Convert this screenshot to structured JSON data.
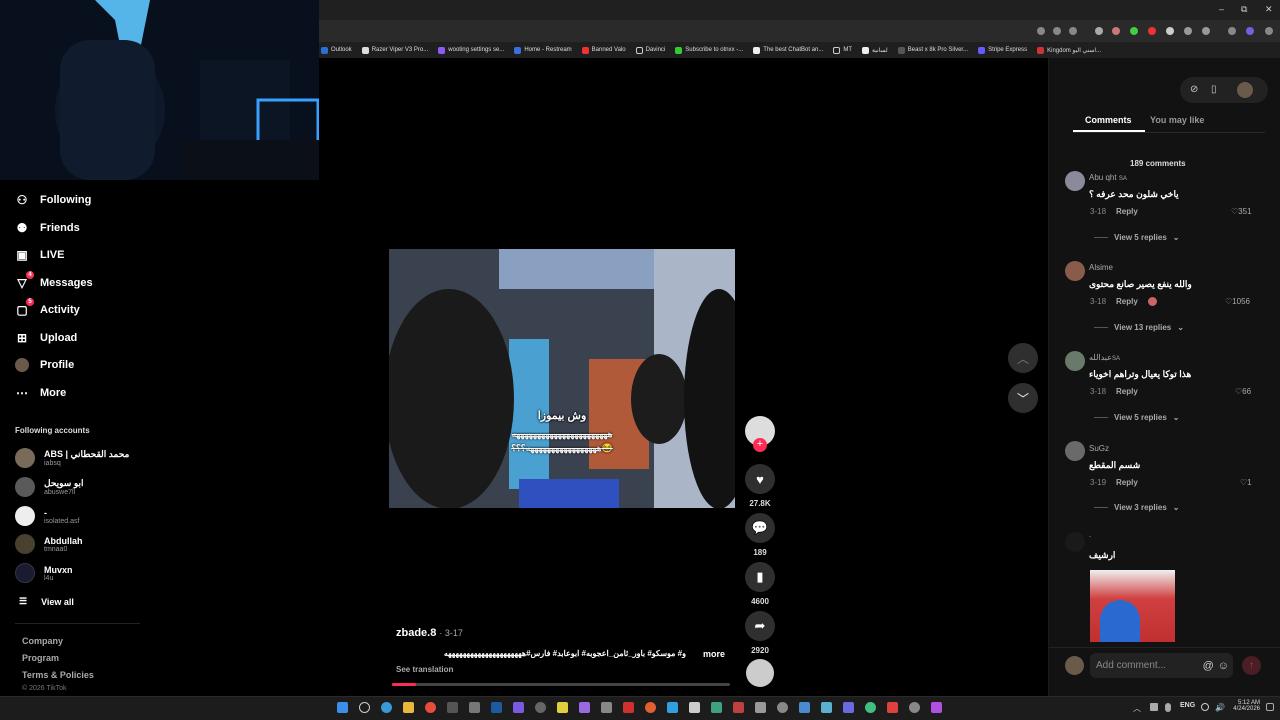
{
  "browser": {
    "bookmarks": [
      "Outlook",
      "Razer Viper V3 Pro...",
      "wooting settings se...",
      "Home - Restream",
      "Banned Valo",
      "Davinci",
      "Subscribe to otnxx -...",
      "The best ChatBot an...",
      "MT",
      "لسانية",
      "Beast x 8k Pro Silver...",
      "Stripe Express",
      "Kingdom اسني اليو..."
    ],
    "window_controls": [
      "–",
      "⧉",
      "✕"
    ]
  },
  "sidebar": {
    "items": [
      {
        "label": "Following",
        "icon": "following-icon"
      },
      {
        "label": "Friends",
        "icon": "friends-icon"
      },
      {
        "label": "LIVE",
        "icon": "live-icon"
      },
      {
        "label": "Messages",
        "icon": "messages-icon",
        "badge": "4"
      },
      {
        "label": "Activity",
        "icon": "activity-icon",
        "badge": "5"
      },
      {
        "label": "Upload",
        "icon": "upload-icon"
      },
      {
        "label": "Profile",
        "icon": "profile-icon"
      },
      {
        "label": "More",
        "icon": "more-icon"
      }
    ],
    "following_title": "Following accounts",
    "accounts": [
      {
        "name": "ABS | محمد القحطاني",
        "handle": "iabsq"
      },
      {
        "name": "ابو سويحل",
        "handle": "abuswe7ll"
      },
      {
        "name": "-",
        "handle": "isolated.asf"
      },
      {
        "name": "Abdullah",
        "handle": "tmnaa0"
      },
      {
        "name": "Muvxn",
        "handle": "l4u"
      }
    ],
    "view_all": "View all",
    "footer": [
      "Company",
      "Program",
      "Terms & Policies",
      "© 2026 TikTok"
    ]
  },
  "video": {
    "overlay_title": "وش بيموزا",
    "overlay_line1": "هههههههههههههههههههههههه",
    "overlay_line2": "هههههههههههههههههه؟؟؟😂",
    "author": "zbade.8",
    "date": "· 3-17",
    "caption": "و# موسكو# باور_ثامن_اعجوبه# ابوعابد# فارس#هههههههههههههههههههههه",
    "more": "more",
    "see_translation": "See translation",
    "actions": {
      "likes": "27.8K",
      "comments": "189",
      "saves": "4600",
      "shares": "2920"
    }
  },
  "comments": {
    "tabs": [
      "Comments",
      "You may like"
    ],
    "count_label": "189 comments",
    "items": [
      {
        "name": "Abu qht",
        "flag": "SA",
        "text": "ياخي شلون محد عرفه ؟",
        "date": "3-18",
        "reply": "Reply",
        "likes": "351",
        "replies": "View 5 replies"
      },
      {
        "name": "Alsime",
        "flag": "",
        "text": "والله ينفع يصير صانع محتوى",
        "date": "3-18",
        "reply": "Reply",
        "likes": "1056",
        "replies": "View 13 replies"
      },
      {
        "name": "عبدالله",
        "flag": "SA",
        "text": "هذا توكا يعيال وتراهم اخوياء",
        "date": "3-18",
        "reply": "Reply",
        "likes": "66",
        "replies": "View 5 replies"
      },
      {
        "name": "SuGz",
        "flag": "",
        "text": "شسم المقطع",
        "date": "3-19",
        "reply": "Reply",
        "likes": "1",
        "replies": "View 3 replies"
      },
      {
        "name": ".",
        "flag": "",
        "text": "ارشيف",
        "date": "",
        "reply": "",
        "likes": "",
        "replies": ""
      }
    ],
    "add_placeholder": "Add comment..."
  },
  "taskbar": {
    "lang": "ENG",
    "time": "5:12 AM",
    "date": "4/24/2026"
  }
}
